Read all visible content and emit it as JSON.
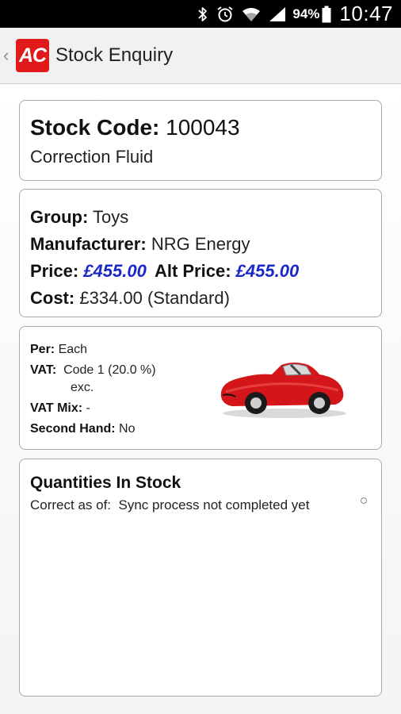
{
  "status_bar": {
    "battery_percent": "94%",
    "time": "10:47",
    "icons": [
      "bluetooth-icon",
      "alarm-icon",
      "wifi-icon",
      "cell-signal-icon",
      "battery-icon"
    ]
  },
  "action_bar": {
    "logo_text": "AC",
    "title": "Stock Enquiry"
  },
  "stock": {
    "code_label": "Stock Code:",
    "code_value": "100043",
    "description": "Correction Fluid"
  },
  "details": {
    "group_label": "Group:",
    "group_value": "Toys",
    "manufacturer_label": "Manufacturer:",
    "manufacturer_value": "NRG Energy",
    "price_label": "Price:",
    "price_value": "£455.00",
    "alt_price_label": "Alt Price:",
    "alt_price_value": "£455.00",
    "cost_label": "Cost:",
    "cost_value": "£334.00 (Standard)",
    "price_color": "#1a28c8"
  },
  "attributes": {
    "per_label": "Per:",
    "per_value": "Each",
    "vat_label": "VAT:",
    "vat_value_line1": "Code 1 (20.0 %)",
    "vat_value_line2": "exc.",
    "vat_mix_label": "VAT Mix:",
    "vat_mix_value": "-",
    "second_hand_label": "Second Hand:",
    "second_hand_value": "No",
    "image_icon": "toy-car-image"
  },
  "quantities": {
    "title": "Quantities In Stock",
    "correct_as_of_label": "Correct as of:",
    "correct_as_of_value": "Sync process not completed yet"
  },
  "colors": {
    "brand_red": "#e01a1a",
    "status_bar": "#000000",
    "action_bar": "#f1f1f1"
  }
}
